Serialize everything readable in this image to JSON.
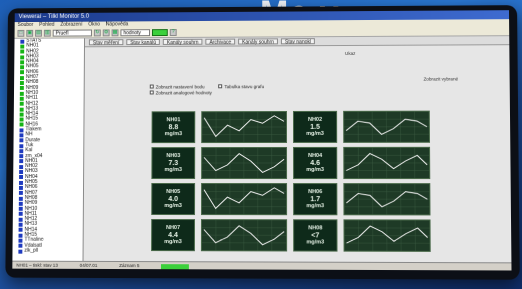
{
  "background_heading": "Ma y…",
  "window": {
    "title": "Vieweraí – Tilkl Monitor 5.0"
  },
  "menu": [
    "Soubor",
    "Pohled",
    "Zobrazení",
    "Okno",
    "Nápověda"
  ],
  "toolbar": {
    "field_value": "Pruefl",
    "field2_value": "hodnoty"
  },
  "sidebar": {
    "items": [
      {
        "label": "STATS",
        "color": "blue"
      },
      {
        "label": "NH01",
        "color": "green"
      },
      {
        "label": "NH02",
        "color": "green"
      },
      {
        "label": "NH03",
        "color": "green"
      },
      {
        "label": "NH04",
        "color": "green"
      },
      {
        "label": "NH05",
        "color": "green"
      },
      {
        "label": "NH06",
        "color": "green"
      },
      {
        "label": "NH07",
        "color": "green"
      },
      {
        "label": "NH08",
        "color": "green"
      },
      {
        "label": "NH09",
        "color": "green"
      },
      {
        "label": "NH10",
        "color": "green"
      },
      {
        "label": "NH11",
        "color": "green"
      },
      {
        "label": "NH12",
        "color": "green"
      },
      {
        "label": "NH13",
        "color": "green"
      },
      {
        "label": "NH14",
        "color": "green"
      },
      {
        "label": "NH15",
        "color": "green"
      },
      {
        "label": "NH16",
        "color": "green"
      },
      {
        "label": "Tlakem",
        "color": "blue"
      },
      {
        "label": "NH",
        "color": "blue"
      },
      {
        "label": "Durate",
        "color": "blue"
      },
      {
        "label": "Tuk",
        "color": "blue"
      },
      {
        "label": "Kal",
        "color": "blue"
      },
      {
        "label": "zm_x04",
        "color": "blue"
      },
      {
        "label": "NH01",
        "color": "blue"
      },
      {
        "label": "NH02",
        "color": "blue"
      },
      {
        "label": "NH03",
        "color": "blue"
      },
      {
        "label": "NH04",
        "color": "blue"
      },
      {
        "label": "NH05",
        "color": "blue"
      },
      {
        "label": "NH06",
        "color": "blue"
      },
      {
        "label": "NH07",
        "color": "blue"
      },
      {
        "label": "NH08",
        "color": "blue"
      },
      {
        "label": "NH09",
        "color": "blue"
      },
      {
        "label": "NH10",
        "color": "blue"
      },
      {
        "label": "NH11",
        "color": "blue"
      },
      {
        "label": "NH12",
        "color": "blue"
      },
      {
        "label": "NH13",
        "color": "blue"
      },
      {
        "label": "NH14",
        "color": "blue"
      },
      {
        "label": "NH15",
        "color": "blue"
      },
      {
        "label": "TTnaline",
        "color": "blue"
      },
      {
        "label": "Vdalsatl",
        "color": "blue"
      },
      {
        "label": "zlk_pll",
        "color": "blue"
      }
    ]
  },
  "tabs": [
    "Stav měření",
    "Stav kanálů",
    "Kanály souhrn",
    "Archivace",
    "Kanály souhrn",
    "Stav nanokl"
  ],
  "header_right": "Ukaz",
  "filter_label": "Zobrazit vybrané",
  "options": {
    "opt1": "Zobrazit nastavení bodu",
    "opt2": "Tabulka stavu grafu",
    "opt3": "Zobrazit analogové hodnoty"
  },
  "monitors": [
    {
      "name": "NH01",
      "value": "8.8",
      "unit": "mg/m3"
    },
    {
      "name": "NH02",
      "value": "1.5",
      "unit": "mg/m3"
    },
    {
      "name": "NH03",
      "value": "7.3",
      "unit": "mg/m3"
    },
    {
      "name": "NH04",
      "value": "4.6",
      "unit": "mg/m3"
    },
    {
      "name": "NH05",
      "value": "4.0",
      "unit": "mg/m3"
    },
    {
      "name": "NH06",
      "value": "1.7",
      "unit": "mg/m3"
    },
    {
      "name": "NH07",
      "value": "4.4",
      "unit": "mg/m3"
    },
    {
      "name": "NH08",
      "value": "<7",
      "unit": "mg/m3"
    }
  ],
  "status": {
    "left": "NH01 – tiskl: stav 13",
    "mid1": "04/07.01",
    "mid2": "Záznam 5"
  },
  "colors": {
    "ok_green": "#3bd03b",
    "box_bg": "#0e2a1a"
  }
}
